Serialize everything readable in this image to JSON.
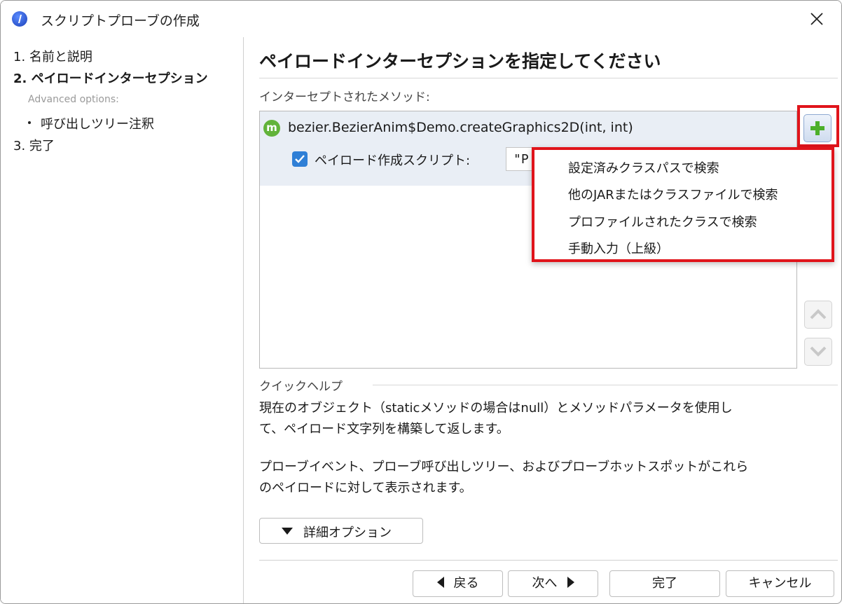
{
  "window": {
    "title": "スクリプトプローブの作成"
  },
  "sidebar": {
    "steps": [
      {
        "label": "1. 名前と説明"
      },
      {
        "label": "2. ペイロードインターセプション"
      },
      {
        "label": "3. 完了"
      }
    ],
    "advanced_label": "Advanced options:",
    "sub_items": [
      {
        "label": "呼び出しツリー注釈"
      }
    ]
  },
  "main": {
    "heading": "ペイロードインターセプションを指定してください",
    "section_label": "インターセプトされたメソッド:",
    "method": {
      "icon_letter": "m",
      "name": "bezier.BezierAnim$Demo.createGraphics2D(int, int)",
      "script_label": "ペイロード作成スクリプト:",
      "script_value": "\"P",
      "checked": true
    },
    "add_menu": {
      "items": [
        {
          "label": "設定済みクラスパスで検索"
        },
        {
          "label": "他のJARまたはクラスファイルで検索"
        },
        {
          "label": "プロファイルされたクラスで検索"
        },
        {
          "label": "手動入力（上級）"
        }
      ]
    },
    "quick_help": {
      "title": "クイックヘルプ",
      "paragraph1_line1": "現在のオブジェクト（staticメソッドの場合はnull）とメソッドパラメータを使用し",
      "paragraph1_line2": "て、ペイロード文字列を構築して返します。",
      "paragraph2_line1": "プローブイベント、プローブ呼び出しツリー、およびプローブホットスポットがこれら",
      "paragraph2_line2": "のペイロードに対して表示されます。"
    },
    "details_button": "詳細オプション"
  },
  "footer": {
    "back": "戻る",
    "next": "次へ",
    "finish": "完了",
    "cancel": "キャンセル"
  },
  "colors": {
    "highlight": "#e0141b",
    "selection_bg": "#e9eef5",
    "checkbox": "#2f7fd6",
    "method_icon": "#62b33a",
    "add_icon": "#4caf2a"
  }
}
